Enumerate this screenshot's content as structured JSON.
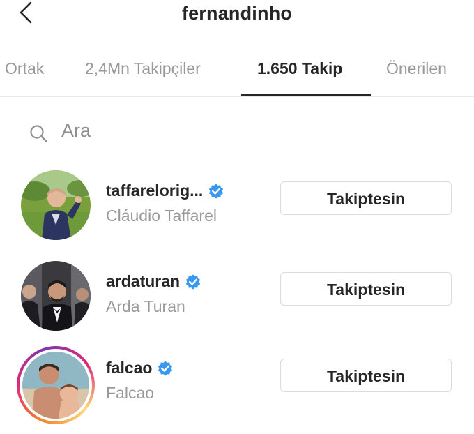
{
  "header": {
    "title": "fernandinho",
    "back_icon": "chevron-left-icon"
  },
  "tabs": [
    {
      "label": "Ortak",
      "active": false
    },
    {
      "label": "2,4Mn Takipçiler",
      "active": false
    },
    {
      "label": "1.650 Takip",
      "active": true
    },
    {
      "label": "Önerilen",
      "active": false
    }
  ],
  "search": {
    "icon": "search-icon",
    "placeholder": "Ara"
  },
  "following": [
    {
      "username": "taffarelorig...",
      "full_name": "Cláudio Taffarel",
      "verified": true,
      "button_label": "Takiptesin",
      "has_story": false
    },
    {
      "username": "ardaturan",
      "full_name": "Arda Turan",
      "verified": true,
      "button_label": "Takiptesin",
      "has_story": false
    },
    {
      "username": "falcao",
      "full_name": "Falcao",
      "verified": true,
      "button_label": "Takiptesin",
      "has_story": true
    }
  ],
  "colors": {
    "verified_badge": "#3897f0",
    "primary_text": "#262626",
    "secondary_text": "#999999",
    "border": "#dbdbdb"
  }
}
